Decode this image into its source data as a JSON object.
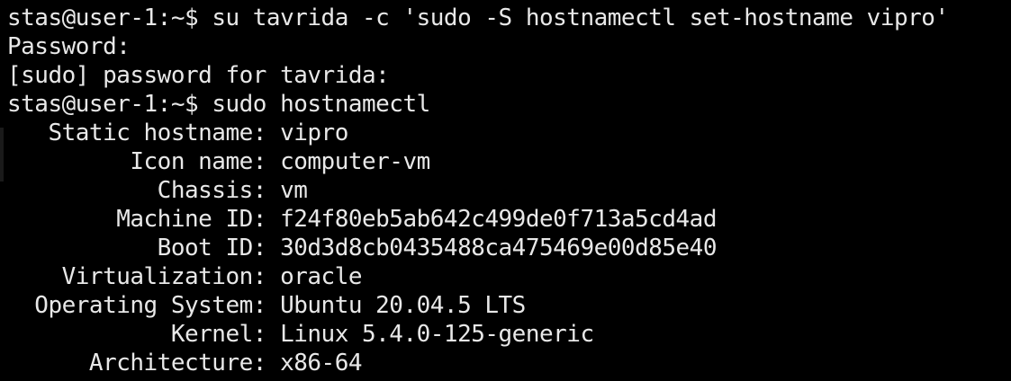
{
  "terminal": {
    "lines": [
      {
        "prompt": "stas@user-1:~$ ",
        "command": "su tavrida -c 'sudo -S hostnamectl set-hostname vipro'"
      },
      {
        "text": "Password:"
      },
      {
        "text": "[sudo] password for tavrida:"
      },
      {
        "prompt": "stas@user-1:~$ ",
        "command": "sudo hostnamectl"
      }
    ],
    "hostnamectl": [
      {
        "key": "   Static hostname: ",
        "value": "vipro"
      },
      {
        "key": "         Icon name: ",
        "value": "computer-vm"
      },
      {
        "key": "           Chassis: ",
        "value": "vm"
      },
      {
        "key": "        Machine ID: ",
        "value": "f24f80eb5ab642c499de0f713a5cd4ad"
      },
      {
        "key": "           Boot ID: ",
        "value": "30d3d8cb0435488ca475469e00d85e40"
      },
      {
        "key": "    Virtualization: ",
        "value": "oracle"
      },
      {
        "key": "  Operating System: ",
        "value": "Ubuntu 20.04.5 LTS"
      },
      {
        "key": "            Kernel: ",
        "value": "Linux 5.4.0-125-generic"
      },
      {
        "key": "      Architecture: ",
        "value": "x86-64"
      }
    ]
  },
  "colors": {
    "background": "#000000",
    "foreground": "#e8e8e8"
  }
}
